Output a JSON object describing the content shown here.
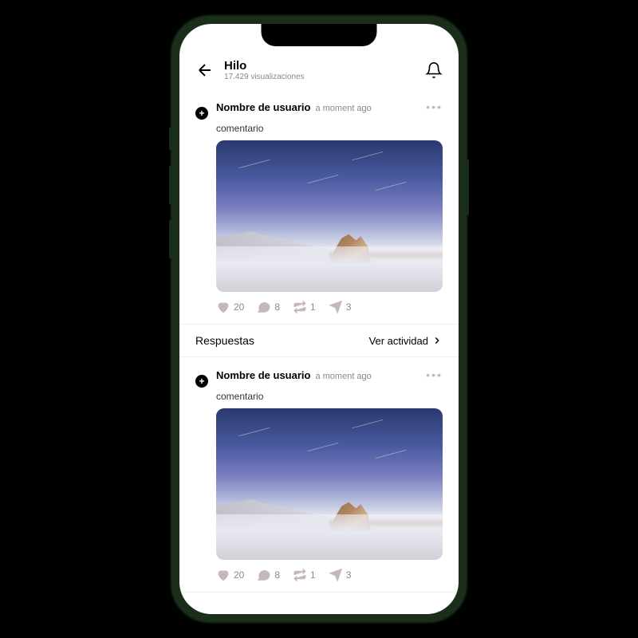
{
  "header": {
    "title": "Hilo",
    "subtitle": "17.429 visualizaciones"
  },
  "posts": [
    {
      "username": "Nombre de usuario",
      "timestamp": "a moment ago",
      "comment": "comentario",
      "likes": "20",
      "comments": "8",
      "reposts": "1",
      "shares": "3"
    },
    {
      "username": "Nombre de usuario",
      "timestamp": "a moment ago",
      "comment": "comentario",
      "likes": "20",
      "comments": "8",
      "reposts": "1",
      "shares": "3"
    }
  ],
  "repliesBar": {
    "label": "Respuestas",
    "activityLink": "Ver actividad"
  }
}
